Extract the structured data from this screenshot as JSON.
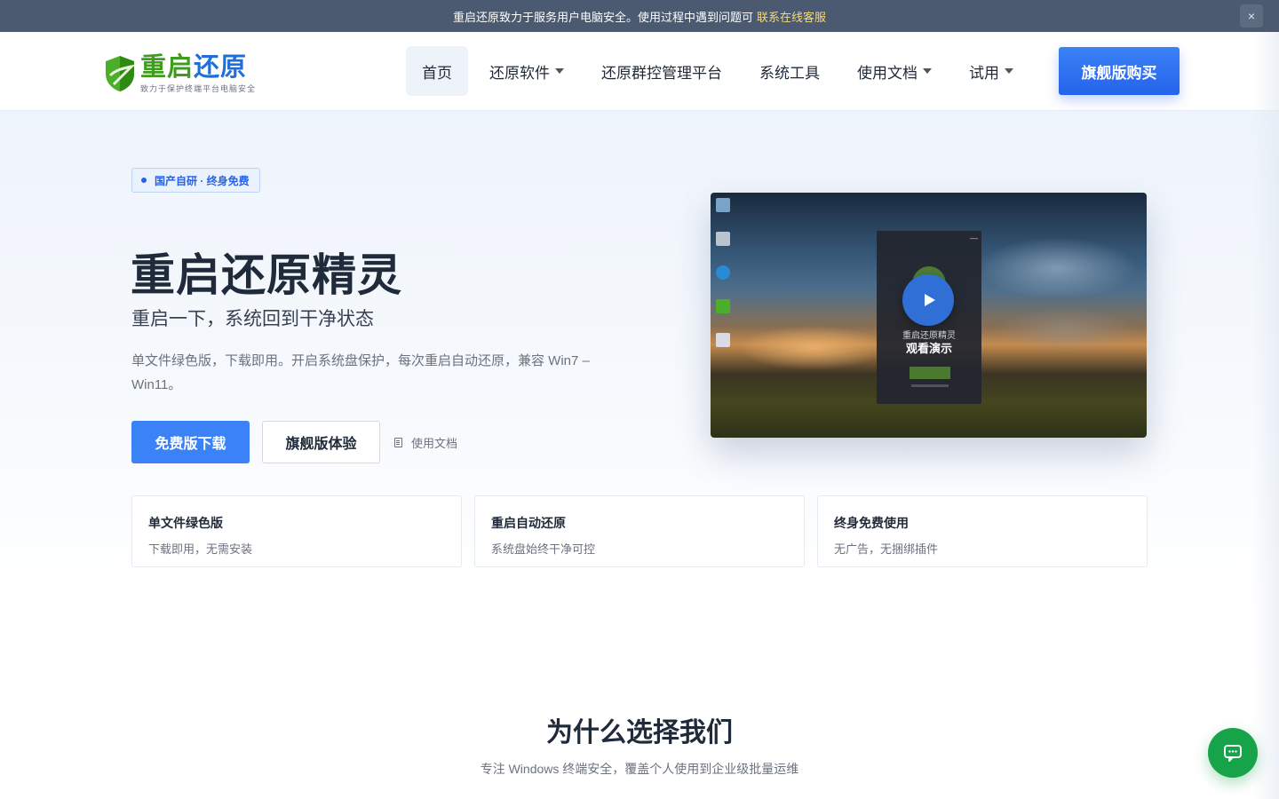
{
  "topbar": {
    "message": "重启还原致力于服务用户电脑安全。使用过程中遇到问题可",
    "link": "联系在线客服",
    "close_label": "×"
  },
  "header": {
    "logo": {
      "title_green": "重启",
      "title_blue": "还原",
      "subtitle": "致力于保护终端平台电脑安全"
    },
    "nav": [
      {
        "label": "首页",
        "active": true,
        "dropdown": false
      },
      {
        "label": "还原软件",
        "active": false,
        "dropdown": true
      },
      {
        "label": "还原群控管理平台",
        "active": false,
        "dropdown": false
      },
      {
        "label": "系统工具",
        "active": false,
        "dropdown": false
      },
      {
        "label": "使用文档",
        "active": false,
        "dropdown": true
      },
      {
        "label": "试用",
        "active": false,
        "dropdown": true
      }
    ],
    "buy_button": "旗舰版购买"
  },
  "hero": {
    "badge": "国产自研 · 终身免费",
    "title": "重启还原精灵",
    "subtitle": "重启一下，系统回到干净状态",
    "description": "单文件绿色版，下载即用。开启系统盘保护，每次重启自动还原，兼容 Win7 – Win11。",
    "primary_button": "免费版下载",
    "secondary_button": "旗舰版体验",
    "doc_link": "使用文档",
    "video": {
      "app_name": "重启还原精灵",
      "watch_label": "观看演示"
    }
  },
  "features": [
    {
      "title": "单文件绿色版",
      "desc": "下载即用，无需安装"
    },
    {
      "title": "重启自动还原",
      "desc": "系统盘始终干净可控"
    },
    {
      "title": "终身免费使用",
      "desc": "无广告，无捆绑插件"
    }
  ],
  "why": {
    "title": "为什么选择我们",
    "subtitle": "专注 Windows 终端安全，覆盖个人使用到企业级批量运维"
  },
  "colors": {
    "primary": "#3b82f6",
    "topbar": "#4b5a70",
    "link_yellow": "#f8d77a",
    "chat_green": "#16a34a",
    "logo_green": "#3f9d1e"
  },
  "icons": [
    "close-icon",
    "shield-logo-icon",
    "chevron-down-icon",
    "document-icon",
    "play-icon",
    "chat-icon"
  ]
}
